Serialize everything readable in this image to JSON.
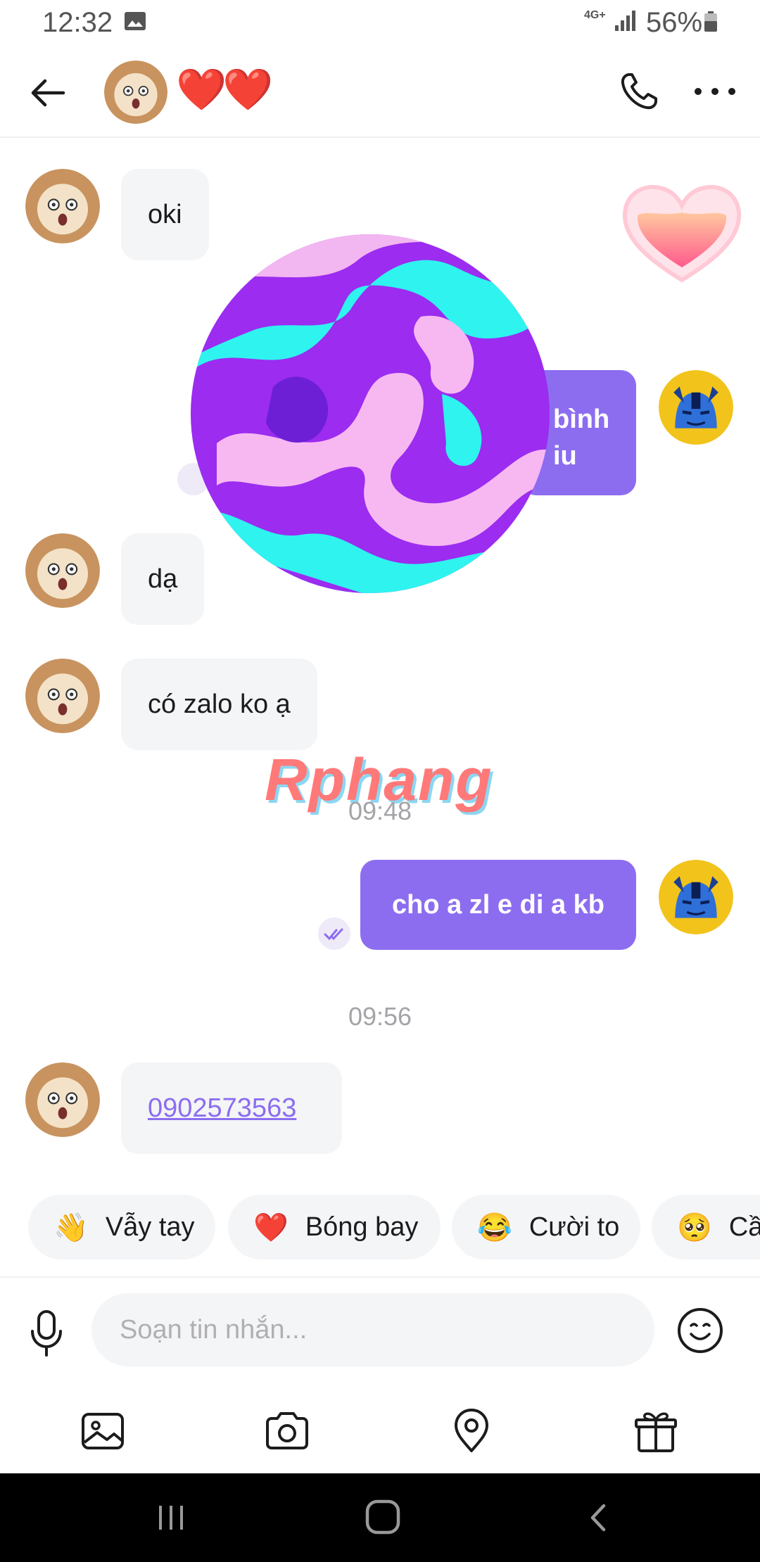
{
  "status_bar": {
    "time": "12:32",
    "network": "4G+",
    "battery": "56%"
  },
  "header": {
    "name": "❤️❤️"
  },
  "messages": {
    "m1": "oki",
    "m2_partial_line1": "bình",
    "m2_partial_line2": "iu",
    "m3": "dạ",
    "m4": "có zalo ko ạ",
    "time1": "09:48",
    "m5": "cho a zl e di a kb",
    "time2": "09:56",
    "m6": "0902573563"
  },
  "watermark": "Rphang",
  "quick_replies": [
    {
      "emoji": "👋",
      "label": "Vẫy tay"
    },
    {
      "emoji": "❤️",
      "label": "Bóng bay"
    },
    {
      "emoji": "😂",
      "label": "Cười to"
    },
    {
      "emoji": "🥺",
      "label": "Cầ"
    }
  ],
  "composer": {
    "placeholder": "Soạn tin nhắn..."
  },
  "colors": {
    "accent": "#8c6df0",
    "bubble_in": "#f4f5f7",
    "link": "#8c6df0"
  }
}
